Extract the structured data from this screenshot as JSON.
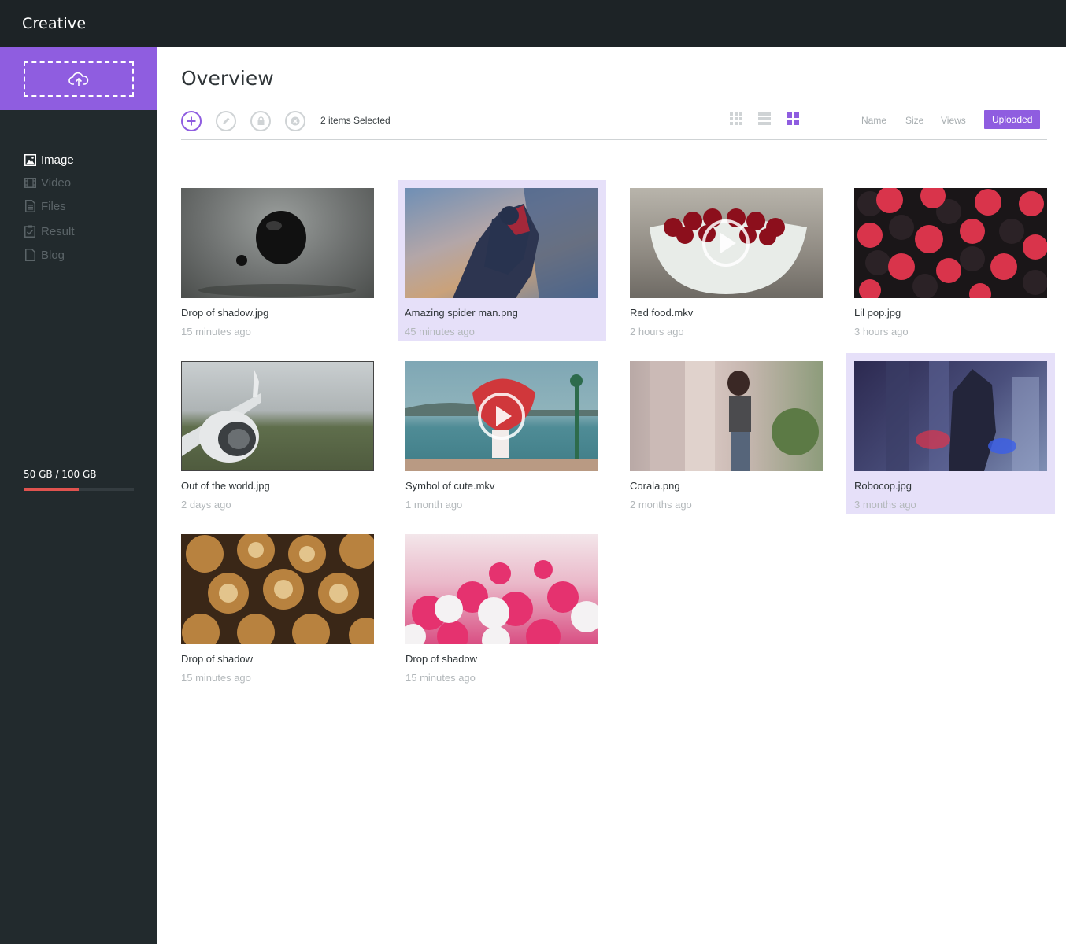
{
  "app": {
    "brand": "Creative"
  },
  "sidebar": {
    "upload_icon": "cloud-upload-icon",
    "items": [
      {
        "label": "Image",
        "icon": "image-icon",
        "active": true
      },
      {
        "label": "Video",
        "icon": "film-icon",
        "active": false
      },
      {
        "label": "Files",
        "icon": "file-icon",
        "active": false
      },
      {
        "label": "Result",
        "icon": "clipboard-check-icon",
        "active": false
      },
      {
        "label": "Blog",
        "icon": "document-icon",
        "active": false
      }
    ],
    "storage": {
      "label": "50 GB / 100 GB",
      "used_fraction": 0.5
    }
  },
  "main": {
    "title": "Overview",
    "toolbar": {
      "actions": [
        "add-icon",
        "edit-icon",
        "lock-icon",
        "delete-icon"
      ],
      "selection_text": "2 items Selected",
      "views": [
        "grid-small-icon",
        "list-icon",
        "grid-large-icon"
      ],
      "active_view": "grid-large-icon",
      "sort_options": [
        "Name",
        "Size",
        "Views",
        "Uploaded"
      ],
      "active_sort": "Uploaded"
    },
    "items": [
      {
        "name": "Drop of shadow.jpg",
        "time": "15 minutes ago",
        "selected": false,
        "video": false
      },
      {
        "name": "Amazing spider man.png",
        "time": "45 minutes ago",
        "selected": true,
        "video": false
      },
      {
        "name": "Red food.mkv",
        "time": "2 hours ago",
        "selected": false,
        "video": true
      },
      {
        "name": "Lil pop.jpg",
        "time": "3 hours ago",
        "selected": false,
        "video": false
      },
      {
        "name": "Out of the world.jpg",
        "time": "2 days ago",
        "selected": false,
        "video": false
      },
      {
        "name": "Symbol of cute.mkv",
        "time": "1 month ago",
        "selected": false,
        "video": true
      },
      {
        "name": "Corala.png",
        "time": "2 months ago",
        "selected": false,
        "video": false
      },
      {
        "name": "Robocop.jpg",
        "time": "3 months ago",
        "selected": true,
        "video": false
      },
      {
        "name": "Drop of shadow",
        "time": "15 minutes ago",
        "selected": false,
        "video": false
      },
      {
        "name": "Drop of shadow",
        "time": "15 minutes ago",
        "selected": false,
        "video": false
      }
    ]
  },
  "colors": {
    "accent": "#8f5de0",
    "sidebar": "#222a2d",
    "topbar": "#1d2326",
    "storage_fill": "#e0534f",
    "selected_bg": "#e6e0f9"
  }
}
